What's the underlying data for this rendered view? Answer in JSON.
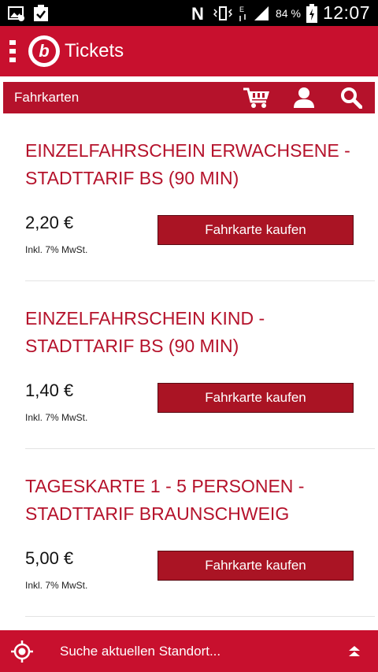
{
  "status_bar": {
    "battery_percent": "84 %",
    "time": "12:07",
    "icons": [
      "image-notification-icon",
      "clipboard-check-icon",
      "nfc-icon",
      "vibrate-icon",
      "data-arrows-icon",
      "signal-icon",
      "battery-icon"
    ]
  },
  "appbar": {
    "logo_letter": "b",
    "title": "Tickets"
  },
  "subbar": {
    "title": "Fahrkarten",
    "icons": [
      "cart-icon",
      "user-icon",
      "search-icon"
    ]
  },
  "tickets": [
    {
      "title": "EINZELFAHRSCHEIN ERWACHSENE - STADTTARIF BS (90 MIN)",
      "price": "2,20 €",
      "vat": "Inkl. 7% MwSt.",
      "button": "Fahrkarte kaufen"
    },
    {
      "title": "EINZELFAHRSCHEIN KIND - STADTTARIF BS (90 MIN)",
      "price": "1,40 €",
      "vat": "Inkl. 7% MwSt.",
      "button": "Fahrkarte kaufen"
    },
    {
      "title": "TAGESKARTE 1 - 5 PERSONEN - STADTTARIF BRAUNSCHWEIG",
      "price": "5,00 €",
      "vat": "Inkl. 7% MwSt.",
      "button": "Fahrkarte kaufen"
    }
  ],
  "bottombar": {
    "text": "Suche aktuellen Standort..."
  },
  "colors": {
    "brand_red": "#c8102e",
    "subbar_red": "#b5122b",
    "button_red": "#aa1424",
    "title_red": "#b5122b"
  }
}
